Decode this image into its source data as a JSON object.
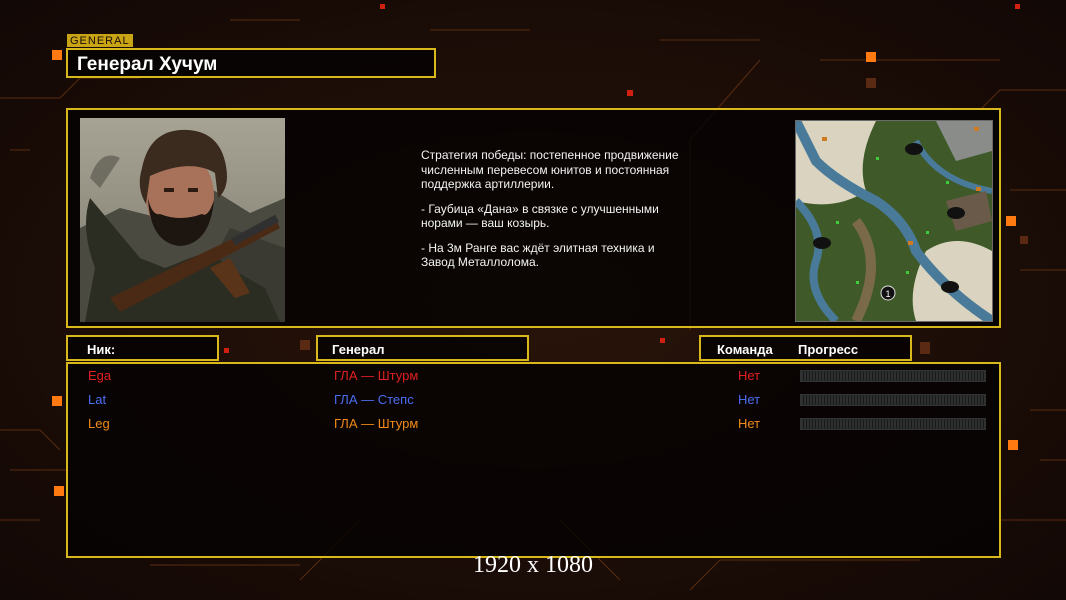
{
  "header": {
    "tag": "GENERAL",
    "title": "Генерал Хучум"
  },
  "description": {
    "lines": [
      "Стратегия победы: постепенное продвижение численным перевесом юнитов и постоянная поддержка артиллерии.",
      "- Гаубица «Дана» в связке с улучшенными норами — ваш козырь.",
      "- На 3м Ранге вас ждёт элитная техника и Завод Металлолома."
    ]
  },
  "minimap": {
    "start_marker": "1"
  },
  "table": {
    "col_nick": "Ник:",
    "col_general": "Генерал",
    "col_team": "Команда",
    "col_progress": "Прогресс",
    "rows": [
      {
        "nick": "Ega",
        "general": "ГЛА — Штурм",
        "team": "Нет",
        "color": "#e02020"
      },
      {
        "nick": "Lat",
        "general": "ГЛА — Степс",
        "team": "Нет",
        "color": "#4a6ef0"
      },
      {
        "nick": "Leg",
        "general": "ГЛА — Штурм",
        "team": "Нет",
        "color": "#f08a18"
      }
    ]
  },
  "caption": "1920 x 1080",
  "colors": {
    "accent": "#d9b81c",
    "background": "#1a0d07",
    "glow": "#ff7a10"
  }
}
